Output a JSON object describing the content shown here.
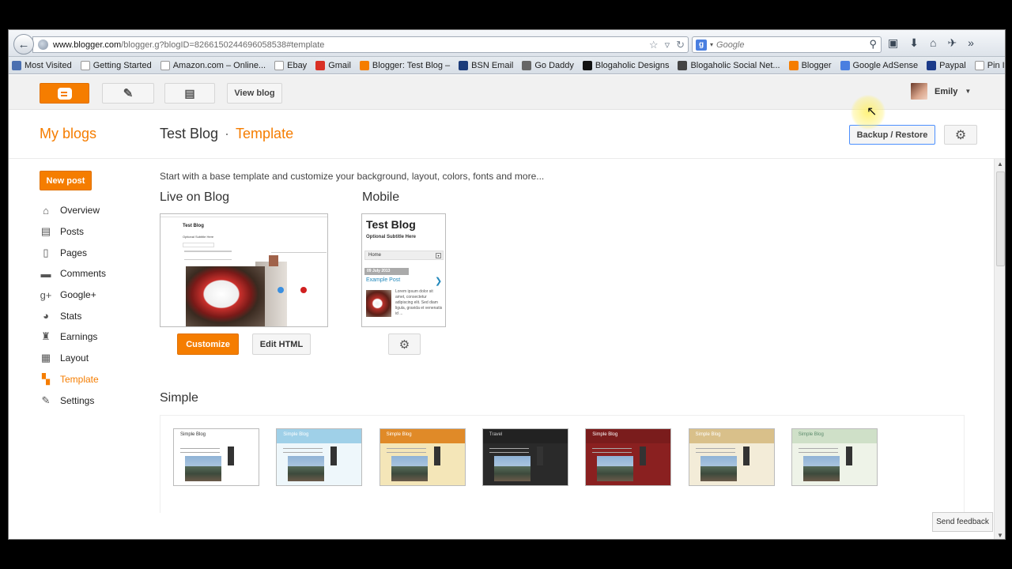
{
  "browser": {
    "url_host": "www.blogger.com",
    "url_path": "/blogger.g?blogID=8266150244696058538#template",
    "search_placeholder": "Google",
    "bookmarks": [
      {
        "label": "Most Visited",
        "icon": "most-visited-icon",
        "color": "#4a6fb0"
      },
      {
        "label": "Getting Started",
        "icon": "page-icon",
        "color": "#ffffff"
      },
      {
        "label": "Amazon.com – Online...",
        "icon": "page-icon",
        "color": "#ffffff"
      },
      {
        "label": "Ebay",
        "icon": "page-icon",
        "color": "#ffffff"
      },
      {
        "label": "Gmail",
        "icon": "gmail-icon",
        "color": "#d93025"
      },
      {
        "label": "Blogger: Test Blog –",
        "icon": "blogger-icon",
        "color": "#f57d00"
      },
      {
        "label": "BSN Email",
        "icon": "email-icon",
        "color": "#1b3b7a"
      },
      {
        "label": "Go Daddy",
        "icon": "godaddy-icon",
        "color": "#666666"
      },
      {
        "label": "Blogaholic Designs",
        "icon": "g-icon",
        "color": "#111111"
      },
      {
        "label": "Blogaholic Social Net...",
        "icon": "square-icon",
        "color": "#444444"
      },
      {
        "label": "Blogger",
        "icon": "blogger-icon",
        "color": "#f57d00"
      },
      {
        "label": "Google AdSense",
        "icon": "google-icon",
        "color": "#4a7fe0"
      },
      {
        "label": "Paypal",
        "icon": "paypal-icon",
        "color": "#1b3b8a"
      },
      {
        "label": "Pin It",
        "icon": "page-icon",
        "color": "#ffffff"
      }
    ]
  },
  "header": {
    "view_blog_label": "View blog",
    "user_name": "Emily"
  },
  "title_row": {
    "my_blogs": "My blogs",
    "blog_name": "Test Blog",
    "separator": "·",
    "current_section": "Template",
    "backup_restore_label": "Backup / Restore"
  },
  "sidebar": {
    "new_post_label": "New post",
    "items": [
      {
        "label": "Overview",
        "icon": "home-icon",
        "glyph": "⌂",
        "active": false
      },
      {
        "label": "Posts",
        "icon": "posts-icon",
        "glyph": "▤",
        "active": false
      },
      {
        "label": "Pages",
        "icon": "pages-icon",
        "glyph": "▯",
        "active": false
      },
      {
        "label": "Comments",
        "icon": "comments-icon",
        "glyph": "▬",
        "active": false
      },
      {
        "label": "Google+",
        "icon": "google-plus-icon",
        "glyph": "g+",
        "active": false
      },
      {
        "label": "Stats",
        "icon": "stats-icon",
        "glyph": "◕",
        "active": false
      },
      {
        "label": "Earnings",
        "icon": "trophy-icon",
        "glyph": "♜",
        "active": false
      },
      {
        "label": "Layout",
        "icon": "layout-icon",
        "glyph": "▦",
        "active": false
      },
      {
        "label": "Template",
        "icon": "template-icon",
        "glyph": "▚",
        "active": true
      },
      {
        "label": "Settings",
        "icon": "wrench-icon",
        "glyph": "✎",
        "active": false
      }
    ]
  },
  "main": {
    "intro": "Start with a base template and customize your background, layout, colors, fonts and more...",
    "live_label": "Live on Blog",
    "mobile_label": "Mobile",
    "customize_label": "Customize",
    "edit_html_label": "Edit HTML",
    "live_preview": {
      "title": "Test Blog",
      "subtitle": "Optional Subtitle Here"
    },
    "mobile_preview": {
      "title": "Test Blog",
      "subtitle": "Optional Subtitle Here",
      "nav": "Home",
      "date": "09 July 2013",
      "post_title": "Example Post",
      "post_text": "Lorem ipsum dolor sit amet, consectetur adipiscing elit. Sed diam ligula, gravida et venenatis id ..."
    },
    "simple_label": "Simple",
    "templates": [
      {
        "name": "Simple Blog",
        "header_color": "#ffffff",
        "header_text": "#333333",
        "bg": "#ffffff"
      },
      {
        "name": "Simple Blog",
        "header_color": "#9fd0e8",
        "header_text": "#ffffff",
        "bg": "#eef7fb"
      },
      {
        "name": "Simple Blog",
        "header_color": "#e08a28",
        "header_text": "#ffffff",
        "bg": "#f4e6b8"
      },
      {
        "name": "Travel",
        "header_color": "#222222",
        "header_text": "#cccccc",
        "bg": "#2a2a2a"
      },
      {
        "name": "Simple Blog",
        "header_color": "#7a1c1c",
        "header_text": "#ffffff",
        "bg": "#8a2020"
      },
      {
        "name": "Simple Blog",
        "header_color": "#d9c08a",
        "header_text": "#ffffff",
        "bg": "#f3ecd8"
      },
      {
        "name": "Simple Blog",
        "header_color": "#cfe0c8",
        "header_text": "#5a8a6a",
        "bg": "#eef3e8"
      }
    ]
  },
  "feedback_label": "Send feedback",
  "colors": {
    "accent": "#f57d00",
    "focus_blue": "#4d90fe"
  }
}
